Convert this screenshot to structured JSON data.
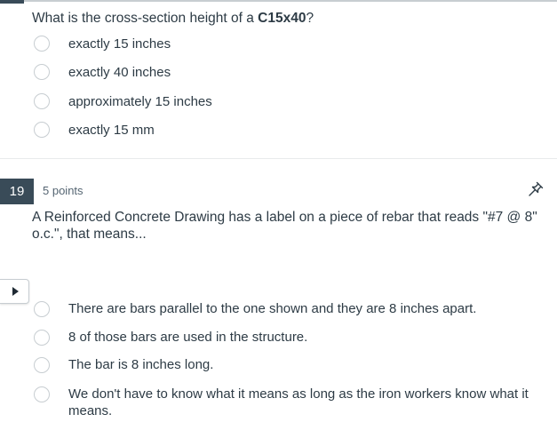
{
  "question18": {
    "text_prefix": "What is the cross-section height of a ",
    "text_bold": "C15x40",
    "text_suffix": "?",
    "answers": [
      "exactly 15 inches",
      "exactly 40 inches",
      "approximately 15 inches",
      "exactly 15 mm"
    ]
  },
  "question19": {
    "number": "19",
    "points": "5 points",
    "text": "A Reinforced Concrete Drawing has a label on a piece of rebar that reads \"#7 @ 8\" o.c.\", that means...",
    "answers": [
      "There are bars parallel to the one shown and they are 8 inches apart.",
      "8 of those bars are used in the structure.",
      "The bar is 8 inches long.",
      "We don't have to know what it means as long as the iron workers know what it means."
    ]
  },
  "icons": {
    "pin": "pin-icon",
    "play": "play-icon"
  },
  "colors": {
    "number_badge": "#394b58",
    "text": "#2d3b45",
    "radio_border": "#c7cdd1"
  }
}
